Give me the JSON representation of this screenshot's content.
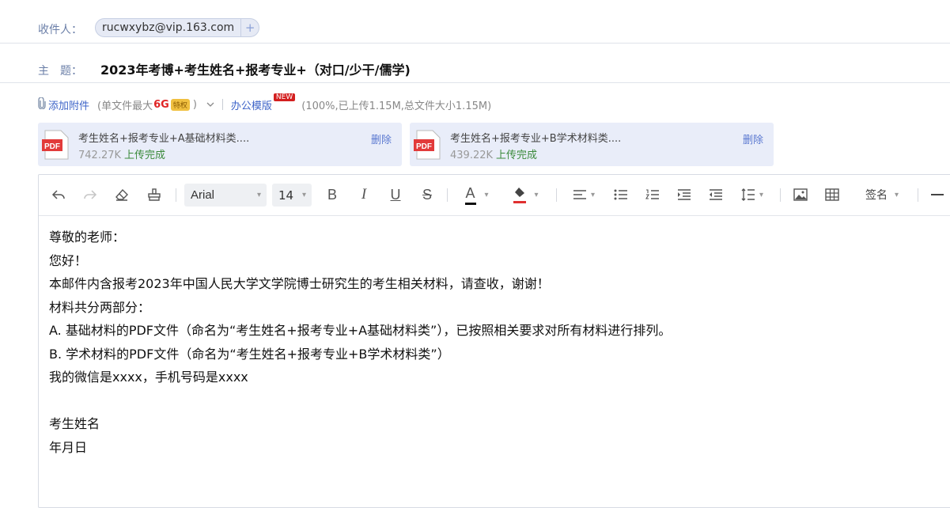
{
  "compose": {
    "to_label": "收件人：",
    "recipient": "rucwxybz@vip.163.com",
    "recipient_add": "+",
    "subject_label": "主　题：",
    "subject": "2023年考博+考生姓名+报考专业+（对口/少干/儒学)"
  },
  "attach": {
    "add_label": "添加附件",
    "limit_prefix": "(单文件最大",
    "limit_size": "6G",
    "perk_badge": "特权",
    "limit_suffix": ")",
    "template_label": "办公模版",
    "new_badge": "NEW",
    "summary": "(100%,已上传1.15M,总文件大小1.15M)",
    "files": [
      {
        "icon": "pdf-icon",
        "icon_text": "PDF",
        "name": "考生姓名+报考专业+A基础材料类....",
        "size": "742.27K",
        "status": "上传完成",
        "delete": "删除"
      },
      {
        "icon": "pdf-icon",
        "icon_text": "PDF",
        "name": "考生姓名+报考专业+B学术材料类....",
        "size": "439.22K",
        "status": "上传完成",
        "delete": "删除"
      }
    ]
  },
  "toolbar": {
    "font": "Arial",
    "size": "14",
    "signature": "签名",
    "icons": [
      "undo-icon",
      "redo-icon",
      "eraser-icon",
      "format-painter-icon",
      "bold-icon",
      "italic-icon",
      "underline-icon",
      "strikethrough-icon",
      "font-color-icon",
      "highlight-icon",
      "align-icon",
      "bullet-list-icon",
      "numbered-list-icon",
      "indent-increase-icon",
      "indent-decrease-icon",
      "line-height-icon",
      "image-icon",
      "table-icon",
      "horizontal-rule-icon"
    ],
    "bold": "B",
    "italic": "I",
    "underline": "U",
    "strike": "S",
    "font_color": "A",
    "font_color_value": "#111111",
    "highlight_color_value": "#e03030"
  },
  "body": {
    "lines": [
      "尊敬的老师：",
      "您好！",
      "本邮件内含报考2023年中国人民大学文学院博士研究生的考生相关材料，请查收，谢谢！",
      "材料共分两部分：",
      "A. 基础材料的PDF文件（命名为“考生姓名+报考专业+A基础材料类”），已按照相关要求对所有材料进行排列。",
      "B. 学术材料的PDF文件（命名为“考生姓名+报考专业+B学术材料类”）",
      "我的微信是xxxx，手机号码是xxxx",
      "",
      "考生姓名",
      "年月日"
    ]
  },
  "colors": {
    "accent": "#3e64c8",
    "label": "#6b7fa8",
    "success": "#3b8a3b",
    "danger": "#d31f1f"
  }
}
